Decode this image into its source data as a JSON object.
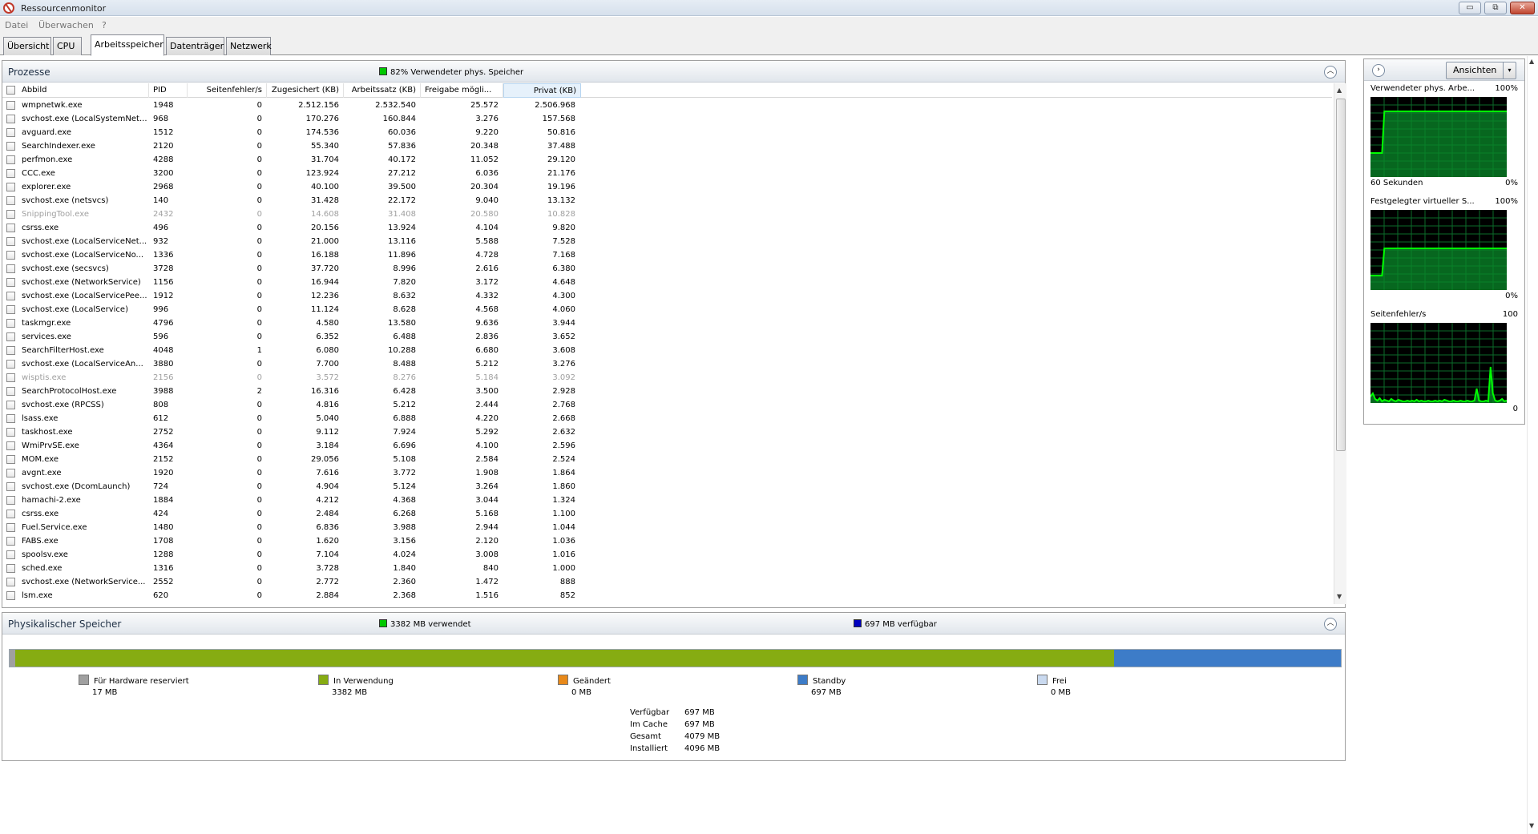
{
  "window": {
    "title": "Ressourcenmonitor",
    "min": "▭",
    "max": "⧉",
    "close": "✕"
  },
  "menu": {
    "items": [
      "Datei",
      "Überwachen",
      "?"
    ]
  },
  "tabs": [
    "Übersicht",
    "CPU",
    "Arbeitsspeicher",
    "Datenträger",
    "Netzwerk"
  ],
  "active_tab": "Arbeitsspeicher",
  "processes": {
    "title": "Prozesse",
    "status": "82% Verwendeter phys. Speicher",
    "status_color": "#00c800",
    "columns": [
      "Abbild",
      "PID",
      "Seitenfehler/s",
      "Zugesichert (KB)",
      "Arbeitssatz (KB)",
      "Freigabe mögli...",
      "Privat (KB)"
    ],
    "sorted_column": "Privat (KB)",
    "rows": [
      [
        "wmpnetwk.exe",
        "1948",
        "0",
        "2.512.156",
        "2.532.540",
        "25.572",
        "2.506.968"
      ],
      [
        "svchost.exe (LocalSystemNet...",
        "968",
        "0",
        "170.276",
        "160.844",
        "3.276",
        "157.568"
      ],
      [
        "avguard.exe",
        "1512",
        "0",
        "174.536",
        "60.036",
        "9.220",
        "50.816"
      ],
      [
        "SearchIndexer.exe",
        "2120",
        "0",
        "55.340",
        "57.836",
        "20.348",
        "37.488"
      ],
      [
        "perfmon.exe",
        "4288",
        "0",
        "31.704",
        "40.172",
        "11.052",
        "29.120"
      ],
      [
        "CCC.exe",
        "3200",
        "0",
        "123.924",
        "27.212",
        "6.036",
        "21.176"
      ],
      [
        "explorer.exe",
        "2968",
        "0",
        "40.100",
        "39.500",
        "20.304",
        "19.196"
      ],
      [
        "svchost.exe (netsvcs)",
        "140",
        "0",
        "31.428",
        "22.172",
        "9.040",
        "13.132"
      ],
      [
        "SnippingTool.exe",
        "2432",
        "0",
        "14.608",
        "31.408",
        "20.580",
        "10.828"
      ],
      [
        "csrss.exe",
        "496",
        "0",
        "20.156",
        "13.924",
        "4.104",
        "9.820"
      ],
      [
        "svchost.exe (LocalServiceNet...",
        "932",
        "0",
        "21.000",
        "13.116",
        "5.588",
        "7.528"
      ],
      [
        "svchost.exe (LocalServiceNo...",
        "1336",
        "0",
        "16.188",
        "11.896",
        "4.728",
        "7.168"
      ],
      [
        "svchost.exe (secsvcs)",
        "3728",
        "0",
        "37.720",
        "8.996",
        "2.616",
        "6.380"
      ],
      [
        "svchost.exe (NetworkService)",
        "1156",
        "0",
        "16.944",
        "7.820",
        "3.172",
        "4.648"
      ],
      [
        "svchost.exe (LocalServicePee...",
        "1912",
        "0",
        "12.236",
        "8.632",
        "4.332",
        "4.300"
      ],
      [
        "svchost.exe (LocalService)",
        "996",
        "0",
        "11.124",
        "8.628",
        "4.568",
        "4.060"
      ],
      [
        "taskmgr.exe",
        "4796",
        "0",
        "4.580",
        "13.580",
        "9.636",
        "3.944"
      ],
      [
        "services.exe",
        "596",
        "0",
        "6.352",
        "6.488",
        "2.836",
        "3.652"
      ],
      [
        "SearchFilterHost.exe",
        "4048",
        "1",
        "6.080",
        "10.288",
        "6.680",
        "3.608"
      ],
      [
        "svchost.exe (LocalServiceAn...",
        "3880",
        "0",
        "7.700",
        "8.488",
        "5.212",
        "3.276"
      ],
      [
        "wisptis.exe",
        "2156",
        "0",
        "3.572",
        "8.276",
        "5.184",
        "3.092"
      ],
      [
        "SearchProtocolHost.exe",
        "3988",
        "2",
        "16.316",
        "6.428",
        "3.500",
        "2.928"
      ],
      [
        "svchost.exe (RPCSS)",
        "808",
        "0",
        "4.816",
        "5.212",
        "2.444",
        "2.768"
      ],
      [
        "lsass.exe",
        "612",
        "0",
        "5.040",
        "6.888",
        "4.220",
        "2.668"
      ],
      [
        "taskhost.exe",
        "2752",
        "0",
        "9.112",
        "7.924",
        "5.292",
        "2.632"
      ],
      [
        "WmiPrvSE.exe",
        "4364",
        "0",
        "3.184",
        "6.696",
        "4.100",
        "2.596"
      ],
      [
        "MOM.exe",
        "2152",
        "0",
        "29.056",
        "5.108",
        "2.584",
        "2.524"
      ],
      [
        "avgnt.exe",
        "1920",
        "0",
        "7.616",
        "3.772",
        "1.908",
        "1.864"
      ],
      [
        "svchost.exe (DcomLaunch)",
        "724",
        "0",
        "4.904",
        "5.124",
        "3.264",
        "1.860"
      ],
      [
        "hamachi-2.exe",
        "1884",
        "0",
        "4.212",
        "4.368",
        "3.044",
        "1.324"
      ],
      [
        "csrss.exe",
        "424",
        "0",
        "2.484",
        "6.268",
        "5.168",
        "1.100"
      ],
      [
        "Fuel.Service.exe",
        "1480",
        "0",
        "6.836",
        "3.988",
        "2.944",
        "1.044"
      ],
      [
        "FABS.exe",
        "1708",
        "0",
        "1.620",
        "3.156",
        "2.120",
        "1.036"
      ],
      [
        "spoolsv.exe",
        "1288",
        "0",
        "7.104",
        "4.024",
        "3.008",
        "1.016"
      ],
      [
        "sched.exe",
        "1316",
        "0",
        "3.728",
        "1.840",
        "840",
        "1.000"
      ],
      [
        "svchost.exe (NetworkService...",
        "2552",
        "0",
        "2.772",
        "2.360",
        "1.472",
        "888"
      ],
      [
        "lsm.exe",
        "620",
        "0",
        "2.884",
        "2.368",
        "1.516",
        "852"
      ]
    ],
    "dimmed_rows": [
      8,
      20
    ]
  },
  "memory": {
    "title": "Physikalischer Speicher",
    "used_status": "3382 MB verwendet",
    "used_color": "#00c800",
    "avail_status": "697 MB verfügbar",
    "avail_color": "#0000c0",
    "segments": [
      {
        "label": "Für Hardware reserviert",
        "value": "17 MB",
        "mb": 17,
        "color": "#a0a0a0"
      },
      {
        "label": "In Verwendung",
        "value": "3382 MB",
        "mb": 3382,
        "color": "#86ac12"
      },
      {
        "label": "Geändert",
        "value": "0 MB",
        "mb": 0,
        "color": "#e8891a"
      },
      {
        "label": "Standby",
        "value": "697 MB",
        "mb": 697,
        "color": "#3d7cc8"
      },
      {
        "label": "Frei",
        "value": "0 MB",
        "mb": 0,
        "color": "#c9d9ef"
      }
    ],
    "summary": [
      {
        "label": "Verfügbar",
        "value": "697 MB"
      },
      {
        "label": "Im Cache",
        "value": "697 MB"
      },
      {
        "label": "Gesamt",
        "value": "4079 MB"
      },
      {
        "label": "Installiert",
        "value": "4096 MB"
      }
    ]
  },
  "side": {
    "expand": "›",
    "views_label": "Ansichten",
    "views_dd": "▾",
    "graphs": [
      {
        "title": "Verwendeter phys. Arbe...",
        "max": "100%",
        "foot_left": "60 Sekunden",
        "foot_right": "0%"
      },
      {
        "title": "Festgelegter virtueller S...",
        "max": "100%",
        "foot_left": "",
        "foot_right": "0%"
      },
      {
        "title": "Seitenfehler/s",
        "max": "100",
        "foot_left": "",
        "foot_right": "0"
      }
    ]
  },
  "chart_data": [
    {
      "type": "area",
      "title": "Verwendeter phys. Arbe...",
      "ylim": [
        0,
        100
      ],
      "unit": "%",
      "x": [
        0,
        1,
        2,
        3,
        4,
        5,
        6,
        7,
        8,
        9,
        10,
        11,
        12,
        13,
        14,
        15,
        16,
        17,
        18,
        19,
        20,
        21,
        22,
        23,
        24,
        25,
        26,
        27,
        28,
        29,
        30,
        31,
        32,
        33,
        34,
        35,
        36,
        37,
        38,
        39,
        40,
        41,
        42,
        43,
        44,
        45,
        46,
        47,
        48,
        49,
        50,
        51,
        52,
        53,
        54,
        55,
        56,
        57,
        58,
        59
      ],
      "values": [
        30,
        30,
        30,
        30,
        30,
        30,
        82,
        82,
        82,
        82,
        82,
        82,
        82,
        82,
        82,
        82,
        82,
        82,
        82,
        82,
        82,
        82,
        82,
        82,
        82,
        82,
        82,
        82,
        82,
        82,
        82,
        82,
        82,
        82,
        82,
        82,
        82,
        82,
        82,
        82,
        82,
        82,
        82,
        82,
        82,
        82,
        82,
        82,
        82,
        82,
        82,
        82,
        82,
        82,
        82,
        82,
        82,
        82,
        82,
        82
      ],
      "color": "#00ff00"
    },
    {
      "type": "area",
      "title": "Festgelegter virtueller S...",
      "ylim": [
        0,
        100
      ],
      "unit": "%",
      "x": [
        0,
        1,
        2,
        3,
        4,
        5,
        6,
        7,
        8,
        9,
        10,
        11,
        12,
        13,
        14,
        15,
        16,
        17,
        18,
        19,
        20,
        21,
        22,
        23,
        24,
        25,
        26,
        27,
        28,
        29,
        30,
        31,
        32,
        33,
        34,
        35,
        36,
        37,
        38,
        39,
        40,
        41,
        42,
        43,
        44,
        45,
        46,
        47,
        48,
        49,
        50,
        51,
        52,
        53,
        54,
        55,
        56,
        57,
        58,
        59
      ],
      "values": [
        18,
        18,
        18,
        18,
        18,
        18,
        52,
        52,
        52,
        52,
        52,
        52,
        52,
        52,
        52,
        52,
        52,
        52,
        52,
        52,
        52,
        52,
        52,
        52,
        52,
        52,
        52,
        52,
        52,
        52,
        52,
        52,
        52,
        52,
        52,
        52,
        52,
        52,
        52,
        52,
        52,
        52,
        52,
        52,
        52,
        52,
        52,
        52,
        52,
        52,
        52,
        52,
        52,
        52,
        52,
        52,
        52,
        52,
        52,
        52
      ],
      "color": "#00ff00"
    },
    {
      "type": "area",
      "title": "Seitenfehler/s",
      "ylim": [
        0,
        100
      ],
      "x": [
        0,
        1,
        2,
        3,
        4,
        5,
        6,
        7,
        8,
        9,
        10,
        11,
        12,
        13,
        14,
        15,
        16,
        17,
        18,
        19,
        20,
        21,
        22,
        23,
        24,
        25,
        26,
        27,
        28,
        29,
        30,
        31,
        32,
        33,
        34,
        35,
        36,
        37,
        38,
        39,
        40,
        41,
        42,
        43,
        44,
        45,
        46,
        47,
        48,
        49,
        50,
        51,
        52,
        53,
        54,
        55,
        56,
        57,
        58,
        59
      ],
      "values": [
        8,
        12,
        5,
        3,
        6,
        2,
        4,
        3,
        2,
        5,
        3,
        2,
        4,
        3,
        2,
        2,
        3,
        2,
        3,
        2,
        4,
        2,
        3,
        2,
        2,
        3,
        2,
        2,
        3,
        2,
        3,
        2,
        4,
        3,
        2,
        2,
        3,
        2,
        2,
        3,
        2,
        2,
        3,
        2,
        2,
        3,
        18,
        3,
        2,
        2,
        3,
        2,
        45,
        12,
        3,
        2,
        3,
        5,
        2,
        3
      ],
      "color": "#00ff00"
    }
  ]
}
